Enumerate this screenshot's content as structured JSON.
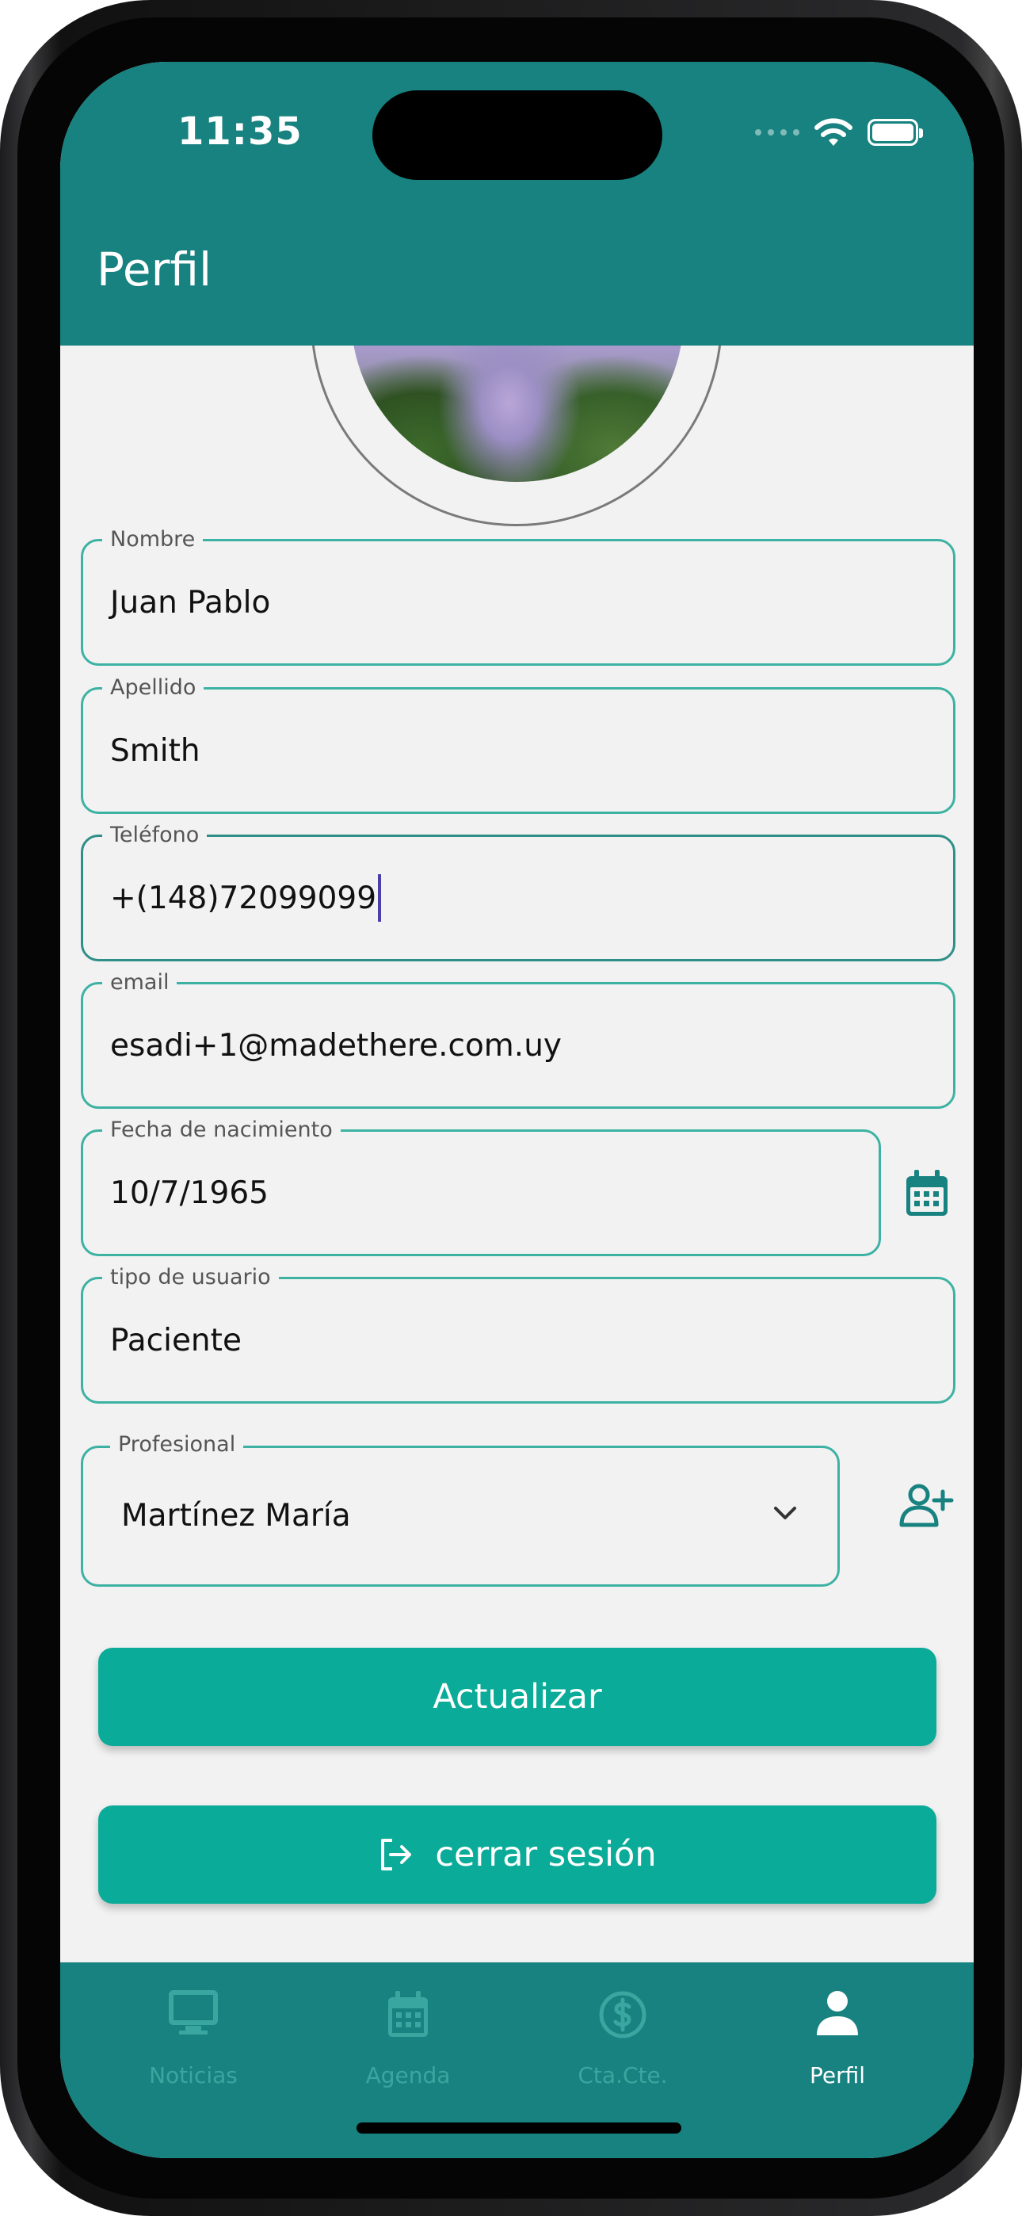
{
  "status_bar": {
    "time": "11:35"
  },
  "app_bar": {
    "title": "Perfil"
  },
  "form": {
    "nombre": {
      "label": "Nombre",
      "value": "Juan Pablo"
    },
    "apellido": {
      "label": "Apellido",
      "value": "Smith"
    },
    "telefono": {
      "label": "Teléfono",
      "value": "+(148)72099099"
    },
    "email": {
      "label": "email",
      "value": "esadi+1@madethere.com.uy"
    },
    "fecha_nacimiento": {
      "label": "Fecha de nacimiento",
      "value": "10/7/1965"
    },
    "tipo_usuario": {
      "label": "tipo de usuario",
      "value": "Paciente"
    },
    "profesional": {
      "label": "Profesional",
      "value": "Martínez María"
    }
  },
  "buttons": {
    "actualizar": "Actualizar",
    "cerrar_sesion": "cerrar sesión"
  },
  "bottom_nav": {
    "items": [
      {
        "label": "Noticias",
        "icon": "monitor-icon",
        "active": false
      },
      {
        "label": "Agenda",
        "icon": "calendar-icon",
        "active": false
      },
      {
        "label": "Cta.Cte.",
        "icon": "dollar-icon",
        "active": false
      },
      {
        "label": "Perfil",
        "icon": "person-icon",
        "active": true
      }
    ]
  },
  "colors": {
    "primary": "#17827f",
    "button": "#0aab98",
    "field_border": "#3db2a3",
    "nav_inactive": "#3aa6a0",
    "background": "#f2f2f2"
  }
}
